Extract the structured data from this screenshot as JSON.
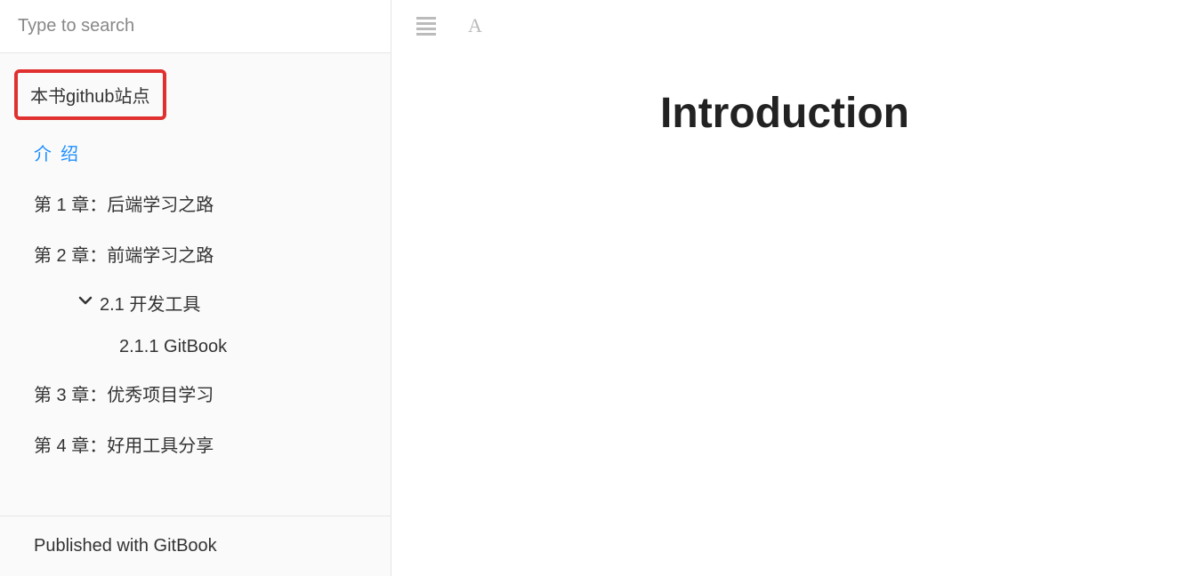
{
  "search": {
    "placeholder": "Type to search"
  },
  "sidebar": {
    "header": "本书github站点",
    "items": [
      {
        "label": "介绍",
        "active": true
      },
      {
        "label": "第 1 章：后端学习之路"
      },
      {
        "label": "第 2 章：前端学习之路"
      },
      {
        "label": "第 3 章：优秀项目学习"
      },
      {
        "label": "第 4 章：好用工具分享"
      }
    ],
    "sub": {
      "chevron_icon": "chevron-down-icon",
      "label": "2.1 开发工具"
    },
    "subsub": {
      "label": "2.1.1 GitBook"
    },
    "footer": "Published with GitBook"
  },
  "toolbar": {
    "menu_icon": "menu-icon",
    "font_icon": "font-icon",
    "font_glyph": "A"
  },
  "content": {
    "title": "Introduction"
  }
}
